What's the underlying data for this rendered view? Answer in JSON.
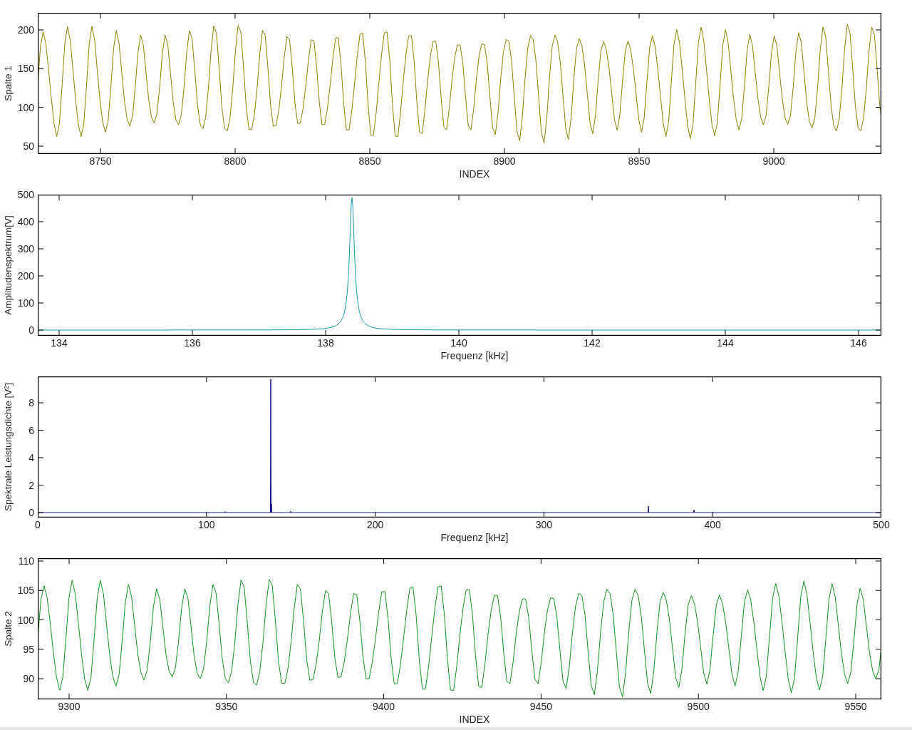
{
  "panels": [
    {
      "kind": "wave",
      "color": "#8a8200",
      "ylabel": "Spalte 1",
      "xlabel": "INDEX",
      "xticks": [
        "8750",
        "8800",
        "8850",
        "8900",
        "8950",
        "9000"
      ],
      "yticks": [
        "200",
        "150",
        "100",
        "50"
      ]
    },
    {
      "kind": "peak",
      "color": "#1a9aa8",
      "ylabel": "Amplitudenspektrum[V]",
      "xlabel": "Frequenz [kHz]",
      "xticks": [
        "134",
        "136",
        "138",
        "140",
        "142",
        "144",
        "146"
      ],
      "yticks": [
        "500",
        "400",
        "300",
        "200",
        "100",
        "0"
      ]
    },
    {
      "kind": "spike",
      "color": "#0a0a8a",
      "ylabel": "Spektrale Leistungsdichte [V$^{2}$]",
      "xlabel": "Frequenz [kHz]",
      "xticks": [
        "0",
        "100",
        "200",
        "300",
        "400",
        "500"
      ],
      "yticks": [
        "8",
        "6",
        "4",
        "2",
        "0"
      ]
    },
    {
      "kind": "wave",
      "color": "#12941e",
      "ylabel": "Spalte 2",
      "xlabel": "INDEX",
      "xticks": [
        "9300",
        "9350",
        "9400",
        "9450",
        "9500",
        "9550"
      ],
      "yticks": [
        "110",
        "105",
        "100",
        "95",
        "90"
      ]
    }
  ]
}
